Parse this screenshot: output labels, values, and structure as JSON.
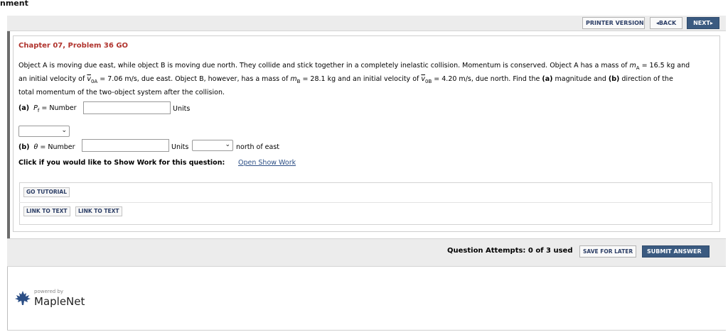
{
  "page": {
    "title_fragment": "nment"
  },
  "header": {
    "printer_version": "PRINTER VERSION",
    "back": "BACK",
    "next": "NEXT"
  },
  "problem": {
    "chapter_title": "Chapter 07, Problem 36 GO",
    "text_line1_a": "Object A is moving due east, while object B is moving due north. They collide and stick together in a completely inelastic collision. Momentum is conserved. Object A has a mass of ",
    "text_line1_var": "m",
    "text_line1_sub": "A",
    "text_line1_b": " = 16.5 kg and",
    "text_line2_a": "an initial velocity of ",
    "v0a_sym": "v",
    "v0a_sub": "0A",
    "text_line2_b": " = 7.06 m/s, due east. Object B, however, has a mass of ",
    "mb_sym": "m",
    "mb_sub": "B",
    "text_line2_c": " = 28.1 kg and an initial velocity of ",
    "v0b_sym": "v",
    "v0b_sub": "0B",
    "text_line2_d": " = 4.20 m/s, due north. Find the ",
    "part_a_ref": "(a)",
    "text_line2_e": " magnitude and ",
    "part_b_ref": "(b)",
    "text_line2_f": " direction of the",
    "text_line3": "total momentum of the two-object system after the collision."
  },
  "part_a": {
    "label": "(a)",
    "symbol": "P",
    "symbol_sub": "f",
    "equals": " = Number",
    "number_value": "",
    "units_label": "Units",
    "units_select_value": ""
  },
  "part_b": {
    "label": "(b)",
    "symbol": "θ",
    "equals": " = Number",
    "number_value": "",
    "units_label": "Units",
    "units_select_value": "",
    "suffix": "north of east"
  },
  "show_work": {
    "prompt": "Click if you would like to Show Work for this question:",
    "link": "Open Show Work"
  },
  "resources": {
    "go_tutorial": "GO TUTORIAL",
    "link_to_text_1": "LINK TO TEXT",
    "link_to_text_2": "LINK TO TEXT"
  },
  "footer": {
    "attempts": "Question Attempts: 0 of 3 used",
    "save_for_later": "SAVE FOR LATER",
    "submit_answer": "SUBMIT ANSWER"
  },
  "branding": {
    "powered_by": "powered by",
    "name": "MapleNet",
    "icon": "maple-leaf-icon"
  },
  "colors": {
    "chapter_title": "#b0332d",
    "primary_button": "#3a5a80",
    "link": "#2c4f86",
    "bar_background": "#ececec"
  }
}
